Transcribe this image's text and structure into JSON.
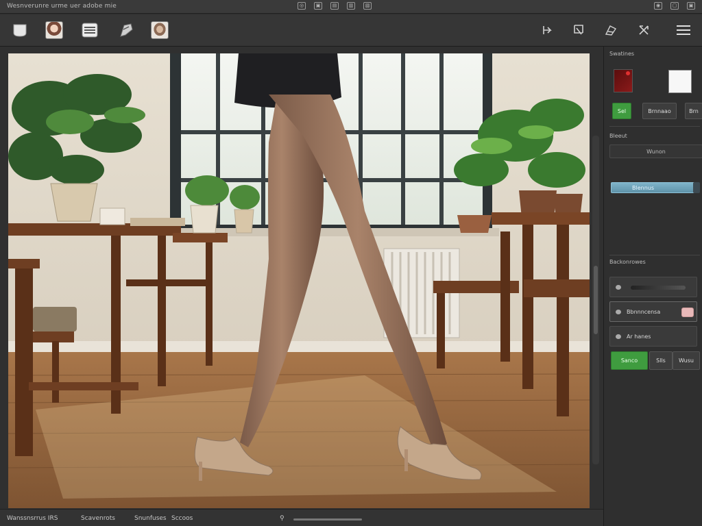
{
  "window": {
    "title": "Wesnverunre  urme uer  adobe  mie"
  },
  "toolbar": {
    "left_tools": [
      "new-layer-icon",
      "photo-thumbnail-icon",
      "stack-icon",
      "brush-stroke-icon",
      "portrait-thumbnail-icon"
    ],
    "right_tools": [
      "move-tool-icon",
      "crop-tool-icon",
      "draw-tool-icon",
      "transform-tool-icon",
      "menu-icon"
    ]
  },
  "panel": {
    "swatches_header": "Swatines",
    "swatch_button": "Sel",
    "swatch_dark_button": "Brnnaao",
    "swatch_trailing_button": "Brn",
    "brush_header": "Bleeut",
    "brush_field": "Wunon",
    "blend_label": "Blennus",
    "adjustments_header": "Backonrowes",
    "layers": [
      {
        "label": ""
      },
      {
        "label": "Bbnnncensa"
      },
      {
        "label": "Ar hanes"
      }
    ],
    "apply_button": "Sanco",
    "secondary_buttons": [
      "Slls",
      "Wusu"
    ]
  },
  "status": {
    "file_info": "Wanssnsrrus IRS",
    "size_info": "Scavenrots",
    "zoom_info": "Snunfuses",
    "view_info": "Sccoos"
  },
  "colors": {
    "foreground_swatch": "#7a1414",
    "background_swatch": "#f7f7f7",
    "accent_green": "#3f9c3f",
    "accent_blue": "#6fa3b9"
  }
}
